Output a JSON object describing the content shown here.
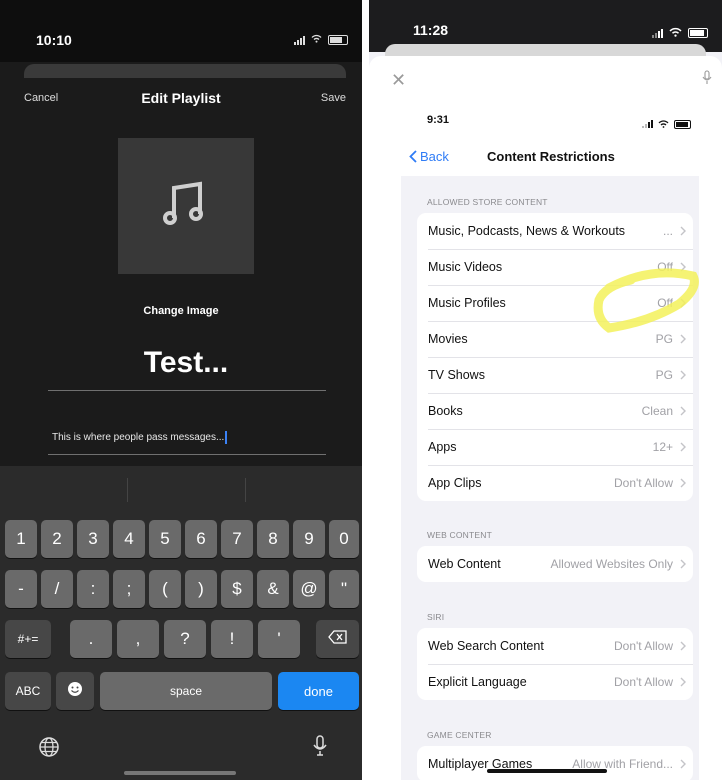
{
  "left": {
    "status": {
      "time": "10:10"
    },
    "nav": {
      "cancel": "Cancel",
      "title": "Edit Playlist",
      "save": "Save"
    },
    "cover_icon": "music-note-icon",
    "change_image": "Change Image",
    "playlist_title": "Test...",
    "description": "This is where people pass messages...",
    "keyboard": {
      "row1": [
        "1",
        "2",
        "3",
        "4",
        "5",
        "6",
        "7",
        "8",
        "9",
        "0"
      ],
      "row2": [
        "-",
        "/",
        ":",
        ";",
        "(",
        ")",
        "$",
        "&",
        "@",
        "\""
      ],
      "row3_left": "#+=",
      "row3": [
        ".",
        ",",
        "?",
        "!",
        "'"
      ],
      "abc": "ABC",
      "space": "space",
      "done": "done"
    },
    "colors": {
      "accent": "#1b87f2",
      "background": "#1b1b1b"
    }
  },
  "right": {
    "status": {
      "time": "11:28"
    },
    "inner_status": {
      "time": "9:31"
    },
    "nav": {
      "back": "Back",
      "title": "Content Restrictions"
    },
    "sections": [
      {
        "header": "ALLOWED STORE CONTENT",
        "rows": [
          {
            "label": "Music, Podcasts, News & Workouts",
            "value": "..."
          },
          {
            "label": "Music Videos",
            "value": "Off"
          },
          {
            "label": "Music Profiles",
            "value": "Off"
          },
          {
            "label": "Movies",
            "value": "PG"
          },
          {
            "label": "TV Shows",
            "value": "PG"
          },
          {
            "label": "Books",
            "value": "Clean"
          },
          {
            "label": "Apps",
            "value": "12+"
          },
          {
            "label": "App Clips",
            "value": "Don't Allow"
          }
        ]
      },
      {
        "header": "WEB CONTENT",
        "rows": [
          {
            "label": "Web Content",
            "value": "Allowed Websites Only"
          }
        ]
      },
      {
        "header": "SIRI",
        "rows": [
          {
            "label": "Web Search Content",
            "value": "Don't Allow"
          },
          {
            "label": "Explicit Language",
            "value": "Don't Allow"
          }
        ]
      },
      {
        "header": "GAME CENTER",
        "rows": [
          {
            "label": "Multiplayer Games",
            "value": "Allow with Friend..."
          }
        ]
      }
    ],
    "colors": {
      "link": "#2f7cf6",
      "highlight": "#f3f15a"
    }
  }
}
